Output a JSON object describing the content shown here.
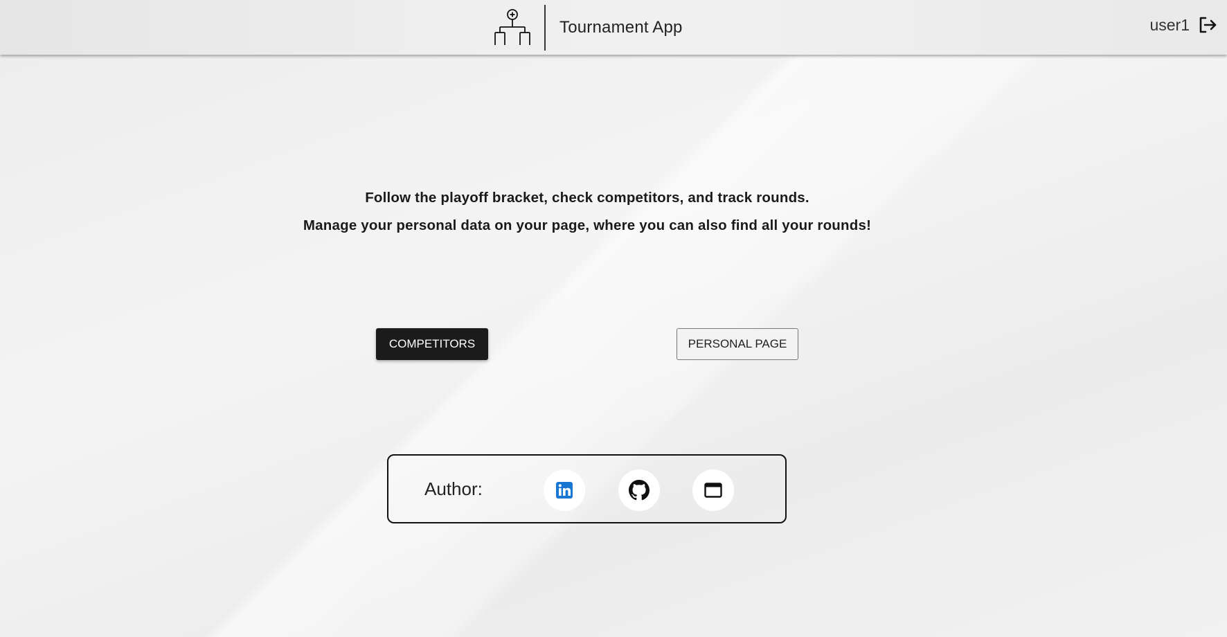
{
  "header": {
    "app_title": "Tournament App",
    "user_name": "user1",
    "logo_icon": "tournament-bracket-icon",
    "logout_icon": "logout-icon"
  },
  "intro": {
    "line1": "Follow the playoff bracket, check competitors, and track rounds.",
    "line2": "Manage your personal data on your page, where you can also find all your rounds!"
  },
  "actions": {
    "competitors_label": "COMPETITORS",
    "personal_page_label": "PERSONAL PAGE"
  },
  "author": {
    "label": "Author:",
    "links": [
      {
        "icon": "linkedin-icon",
        "color": "#1976d2"
      },
      {
        "icon": "github-icon",
        "color": "#111111"
      },
      {
        "icon": "browser-window-icon",
        "color": "#111111"
      }
    ]
  }
}
